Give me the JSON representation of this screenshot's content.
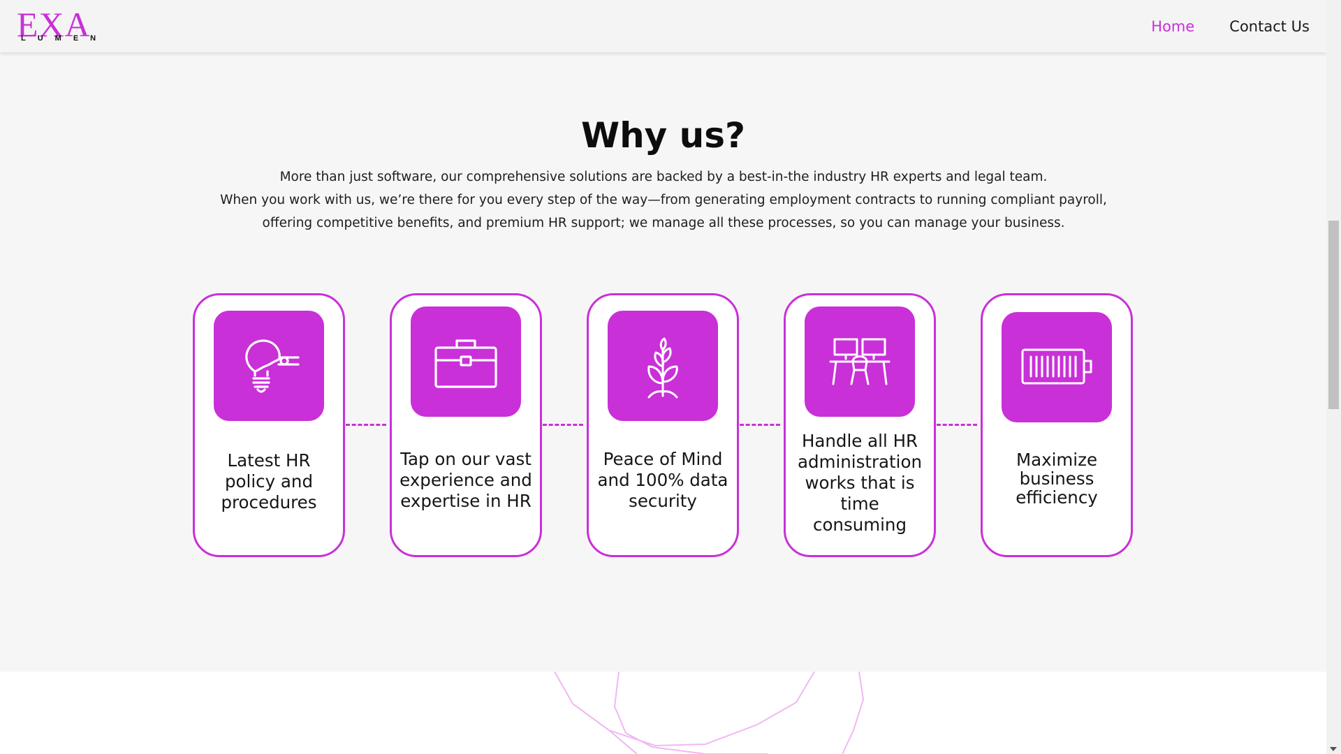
{
  "header": {
    "logo_main": "EXA",
    "logo_sub": "LUMEN",
    "nav": [
      {
        "label": "Home",
        "active": true
      },
      {
        "label": "Contact Us",
        "active": false
      }
    ]
  },
  "why": {
    "title": "Why us?",
    "lines": [
      "More than just software, our comprehensive solutions are backed by a best-in-the industry HR experts and legal team.",
      "When you work with us, we’re there for you every step of the way—from generating employment contracts to running compliant payroll,",
      "offering competitive benefits, and premium HR support; we manage all these processes, so you can manage your business."
    ],
    "cards": [
      {
        "label": "Latest HR policy and procedures",
        "icon": "lightbulb-icon"
      },
      {
        "label": "Tap on our vast experience and expertise in HR",
        "icon": "briefcase-icon"
      },
      {
        "label": "Peace of Mind and 100% data security",
        "icon": "plant-icon"
      },
      {
        "label": "Handle all HR administration works that is time consuming",
        "icon": "workstations-icon"
      },
      {
        "label": "Maximize business efficiency",
        "icon": "battery-icon"
      }
    ]
  },
  "colors": {
    "accent": "#c930d8",
    "background": "#f7f6f7",
    "text": "#111111"
  }
}
